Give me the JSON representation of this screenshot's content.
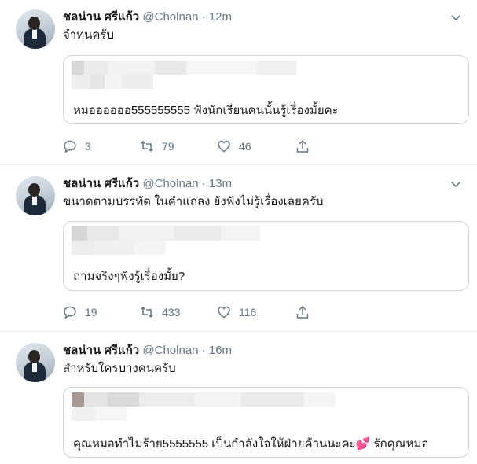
{
  "tweets": [
    {
      "name": "ชลน่าน ศรีแก้ว",
      "handle": "@Cholnan",
      "sep": "·",
      "time": "12m",
      "text": "จำทนครับ",
      "quote_text": "หมออออออ555555555 ฟังนักเรียนคนนั้นรู้เรื่องมั้ยคะ",
      "quote_heart": "",
      "quote_tail": "",
      "replies": "3",
      "retweets": "79",
      "likes": "46"
    },
    {
      "name": "ชลน่าน ศรีแก้ว",
      "handle": "@Cholnan",
      "sep": "·",
      "time": "13m",
      "text": "ขนาดตามบรรทัด ในคำแถลง ยังฟังไม่รู้เรื่องเลยครับ",
      "quote_text": "ถามจริงๆฟังรู้เรื่องมั้ย?",
      "quote_heart": "",
      "quote_tail": "",
      "replies": "19",
      "retweets": "433",
      "likes": "116"
    },
    {
      "name": "ชลน่าน ศรีแก้ว",
      "handle": "@Cholnan",
      "sep": "·",
      "time": "16m",
      "text": "สำหรับใครบางคนครับ",
      "quote_text": "คุณหมอทำไมร้าย5555555 เป็นกำลังใจให้ฝ่ายค้านนะคะ",
      "quote_heart": "💕",
      "quote_tail": "รักคุณหมอ",
      "replies": "",
      "retweets": "",
      "likes": ""
    }
  ],
  "icons": {
    "reply": "reply-icon",
    "retweet": "retweet-icon",
    "like": "heart-icon",
    "share": "share-icon",
    "caret": "chevron-down-icon"
  },
  "colors": {
    "secondary_text": "#657786",
    "border": "#e6ecf0",
    "quote_border": "#ccd6dd",
    "heart_emoji": "#e0245e"
  }
}
